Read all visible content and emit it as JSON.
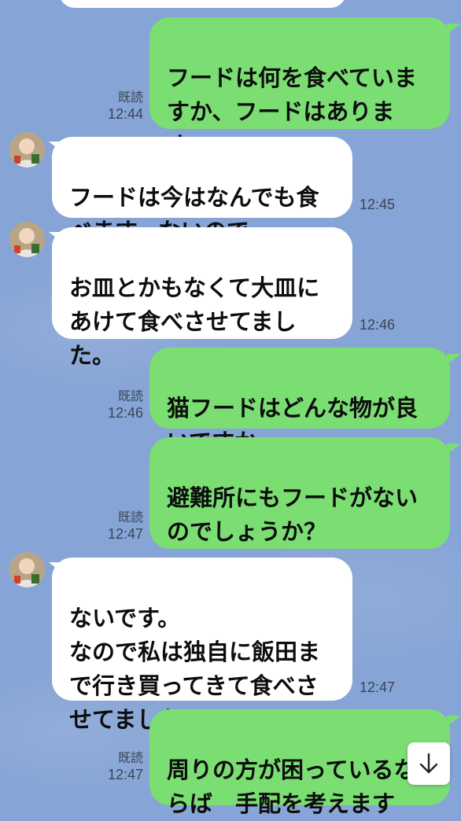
{
  "messages": [
    {
      "side": "out",
      "text": "フードは何を食べていま\nすか、フードはありま\nす\nか？お皿は",
      "read": "既読",
      "time": "12:44"
    },
    {
      "side": "in",
      "text": "フードは今はなんでも食\nべます。ないので",
      "time": "12:45"
    },
    {
      "side": "in",
      "text": "お皿とかもなくて大皿に\nあけて食べさせてまし\nた。",
      "time": "12:46"
    },
    {
      "side": "out",
      "text": "猫フードはどんな物が良\nいですか",
      "read": "既読",
      "time": "12:46"
    },
    {
      "side": "out",
      "text": "避難所にもフードがない\nのでしょうか？",
      "read": "既読",
      "time": "12:47"
    },
    {
      "side": "in",
      "text": "ないです。\nなので私は独自に飯田ま\nで行き買ってきて食べさ\nせてました。",
      "time": "12:47"
    },
    {
      "side": "out",
      "text": "周りの方が困っているな\nらば　手配を考えます",
      "read": "既読",
      "time": "12:47"
    }
  ],
  "scroll_button": {
    "icon": "arrow-down-icon"
  },
  "colors": {
    "background": "#86a4d5",
    "outgoing_bubble": "#7ade73",
    "incoming_bubble": "#ffffff"
  }
}
